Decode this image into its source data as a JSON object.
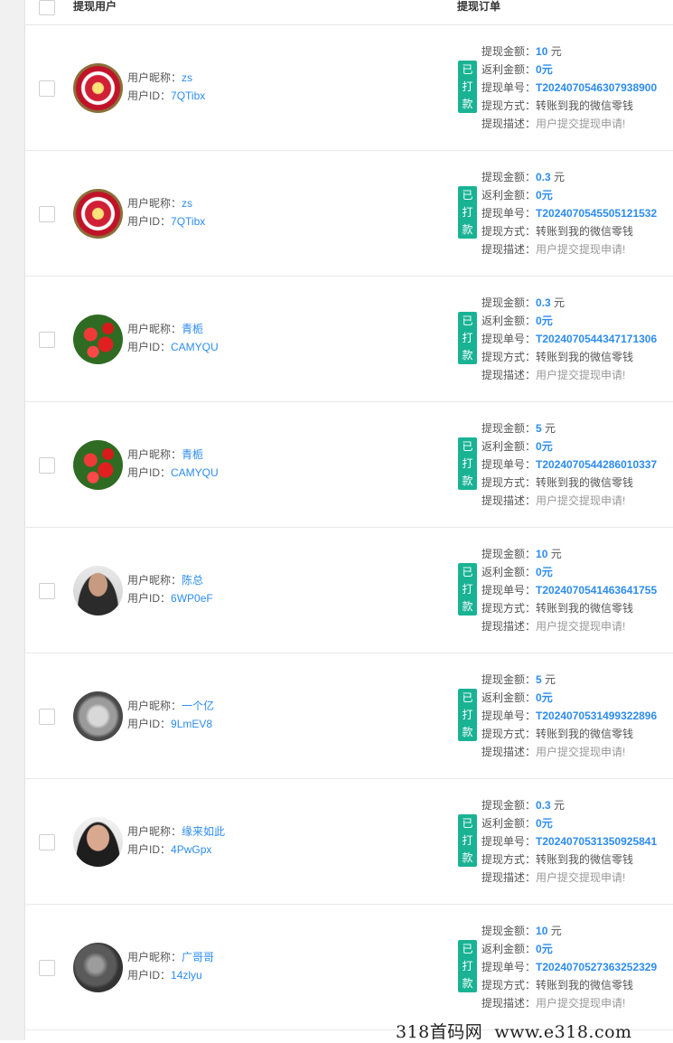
{
  "header": {
    "col_user": "提现用户",
    "col_order": "提现订单"
  },
  "labels": {
    "nickname": "用户昵称：",
    "user_id": "用户ID：",
    "amount": "提现金额：",
    "rebate": "返利金额：",
    "order_no": "提现单号：",
    "method": "提现方式：",
    "desc": "提现描述："
  },
  "rows": [
    {
      "avatar": "flower-avatar",
      "nickname": "zs",
      "uid": "7QTibx",
      "status": "已打款",
      "amount": "10",
      "unit": "元",
      "rebate": "0元",
      "order_no": "T2024070546307938900",
      "method": "转账到我的微信零钱",
      "desc": "用户提交提现申请!"
    },
    {
      "avatar": "flower-avatar",
      "nickname": "zs",
      "uid": "7QTibx",
      "status": "已打款",
      "amount": "0.3",
      "unit": "元",
      "rebate": "0元",
      "order_no": "T2024070545505121532",
      "method": "转账到我的微信零钱",
      "desc": "用户提交提现申请!"
    },
    {
      "avatar": "roses-avatar",
      "nickname": "青栀",
      "uid": "CAMYQU",
      "status": "已打款",
      "amount": "0.3",
      "unit": "元",
      "rebate": "0元",
      "order_no": "T2024070544347171306",
      "method": "转账到我的微信零钱",
      "desc": "用户提交提现申请!"
    },
    {
      "avatar": "roses-avatar",
      "nickname": "青栀",
      "uid": "CAMYQU",
      "status": "已打款",
      "amount": "5",
      "unit": "元",
      "rebate": "0元",
      "order_no": "T2024070544286010337",
      "method": "转账到我的微信零钱",
      "desc": "用户提交提现申请!"
    },
    {
      "avatar": "man-avatar",
      "nickname": "陈总",
      "uid": "6WP0eF",
      "status": "已打款",
      "amount": "10",
      "unit": "元",
      "rebate": "0元",
      "order_no": "T2024070541463641755",
      "method": "转账到我的微信零钱",
      "desc": "用户提交提现申请!"
    },
    {
      "avatar": "pot-avatar",
      "nickname": "一个亿",
      "uid": "9LmEV8",
      "status": "已打款",
      "amount": "5",
      "unit": "元",
      "rebate": "0元",
      "order_no": "T2024070531499322896",
      "method": "转账到我的微信零钱",
      "desc": "用户提交提现申请!"
    },
    {
      "avatar": "man2-avatar",
      "nickname": "缘来如此",
      "uid": "4PwGpx",
      "status": "已打款",
      "amount": "0.3",
      "unit": "元",
      "rebate": "0元",
      "order_no": "T2024070531350925841",
      "method": "转账到我的微信零钱",
      "desc": "用户提交提现申请!"
    },
    {
      "avatar": "dark-avatar",
      "nickname": "广哥哥",
      "uid": "14zlyu",
      "status": "已打款",
      "amount": "10",
      "unit": "元",
      "rebate": "0元",
      "order_no": "T2024070527363252329",
      "method": "转账到我的微信零钱",
      "desc": "用户提交提现申请!"
    }
  ],
  "watermark": "318首码网  www.e318.com",
  "colors": {
    "accent": "#2d8cf0",
    "badge": "#19b394"
  }
}
